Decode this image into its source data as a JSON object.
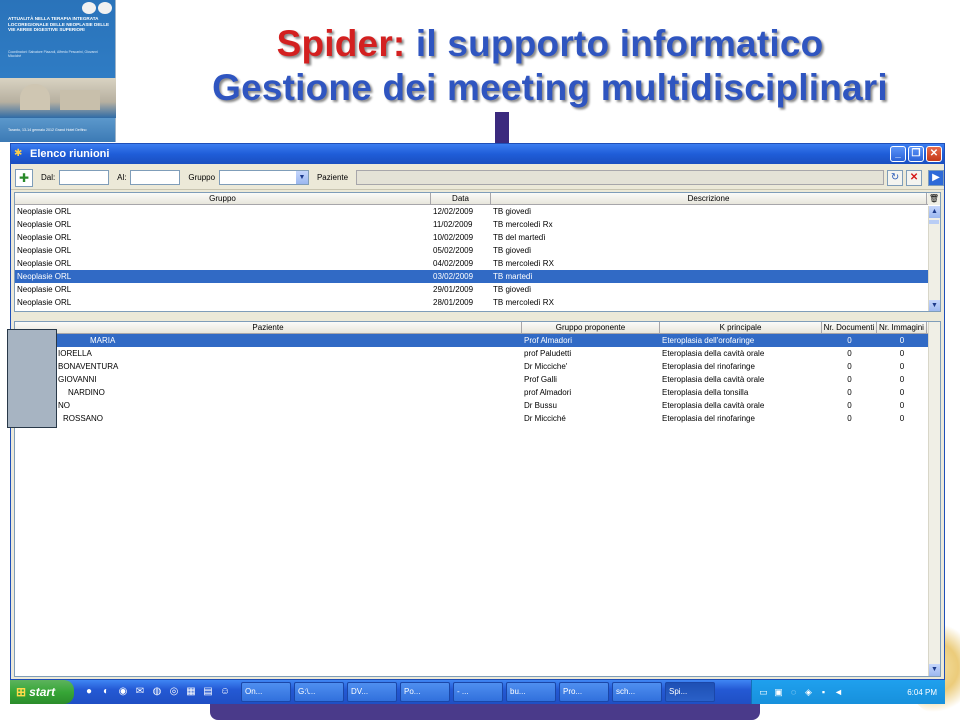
{
  "poster": {
    "heading": "ATTUALITÀ NELLA TERAPIA INTEGRATA LOCOREGIONALE DELLE NEOPLASIE DELLE VIE AEREE DIGESTIVE SUPERIORI",
    "authors": "Coordinatori: Salvatore Piazzoli, Alfredo Pescarini, Giovanni Micciché",
    "date": "Taranto, 13-14 gennaio 2012 Grand Hotel Delfino"
  },
  "title": {
    "line1_red": "Spider:",
    "line1_blue": " il supporto informatico",
    "line2": "Gestione dei meeting multidisciplinari"
  },
  "window": {
    "title": "Elenco riunioni",
    "minimize": "_",
    "maximize": "❐",
    "close": "✕"
  },
  "toolbar": {
    "dal_label": "Dal:",
    "al_label": "Al:",
    "gruppo_label": "Gruppo",
    "paziente_label": "Paziente"
  },
  "meetings": {
    "headers": [
      "Gruppo",
      "Data",
      "Descrizione"
    ],
    "rows": [
      {
        "gruppo": "Neoplasie ORL",
        "data": "12/02/2009",
        "descrizione": "TB giovedì"
      },
      {
        "gruppo": "Neoplasie ORL",
        "data": "11/02/2009",
        "descrizione": "TB mercoledì Rx"
      },
      {
        "gruppo": "Neoplasie ORL",
        "data": "10/02/2009",
        "descrizione": "TB del martedì"
      },
      {
        "gruppo": "Neoplasie ORL",
        "data": "05/02/2009",
        "descrizione": "TB giovedì"
      },
      {
        "gruppo": "Neoplasie ORL",
        "data": "04/02/2009",
        "descrizione": "TB mercoledì RX"
      },
      {
        "gruppo": "Neoplasie ORL",
        "data": "03/02/2009",
        "descrizione": "TB martedì"
      },
      {
        "gruppo": "Neoplasie ORL",
        "data": "29/01/2009",
        "descrizione": "TB giovedì"
      },
      {
        "gruppo": "Neoplasie ORL",
        "data": "28/01/2009",
        "descrizione": "TB mercoledì RX"
      }
    ],
    "selected_index": 5
  },
  "patients": {
    "headers": [
      "Paziente",
      "Gruppo proponente",
      "K principale",
      "Nr. Documenti",
      "Nr. Immagini"
    ],
    "rows": [
      {
        "paziente": "MARIA",
        "gruppo": "Prof Almadori",
        "k": "Eteroplasia dell'orofaringe",
        "doc": "0",
        "img": "0"
      },
      {
        "paziente": "IORELLA",
        "gruppo": "prof Paludetti",
        "k": "Eteroplasia della cavità orale",
        "doc": "0",
        "img": "0"
      },
      {
        "paziente": "BONAVENTURA",
        "gruppo": "Dr Micciche'",
        "k": "Eteroplasia del rinofaringe",
        "doc": "0",
        "img": "0"
      },
      {
        "paziente": "GIOVANNI",
        "gruppo": "Prof Galli",
        "k": "Eteroplasia della cavità orale",
        "doc": "0",
        "img": "0"
      },
      {
        "paziente": "NARDINO",
        "gruppo": "prof Almadori",
        "k": "Eteroplasia della tonsilla",
        "doc": "0",
        "img": "0"
      },
      {
        "paziente": "NO",
        "gruppo": "Dr Bussu",
        "k": "Eteroplasia della cavità orale",
        "doc": "0",
        "img": "0"
      },
      {
        "paziente": "ROSSANO",
        "gruppo": "Dr Micciché",
        "k": "Eteroplasia del rinofaringe",
        "doc": "0",
        "img": "0"
      }
    ],
    "selected_index": 0
  },
  "taskbar": {
    "start_label": "start",
    "tasks": [
      "On...",
      "G:\\...",
      "DV...",
      "Po...",
      "- ...",
      "bu...",
      "Pro...",
      "sch...",
      "Spi..."
    ],
    "active_task": 8,
    "clock": "6:04 PM"
  },
  "icons": {
    "app": "spider-icon",
    "new": "new-document-icon",
    "refresh": "refresh-icon",
    "delete": "delete-icon",
    "next": "next-arrow-icon",
    "trash": "trash-icon"
  },
  "colors": {
    "title_red": "#d32020",
    "title_blue": "#2f55c0",
    "selection": "#316ac5",
    "titlebar": "#1f5dd8"
  }
}
